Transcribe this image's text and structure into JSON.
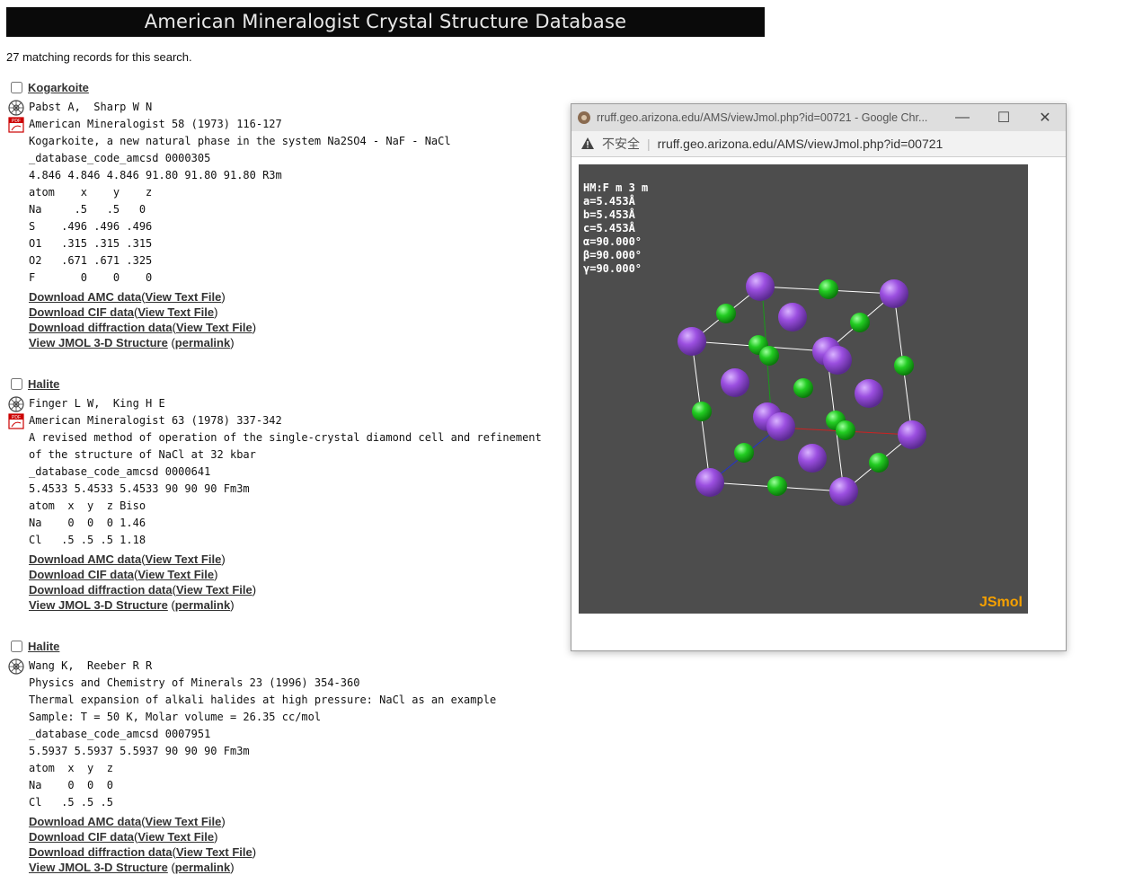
{
  "banner": "American Mineralogist Crystal Structure Database",
  "count_text": "27 matching records for this search.",
  "link_labels": {
    "amc": "Download AMC data",
    "cif": "Download CIF data",
    "diffraction": "Download diffraction data",
    "jmol": "View JMOL 3-D Structure",
    "text_file": "View Text File",
    "permalink": "permalink"
  },
  "records": [
    {
      "title": "Kogarkoite",
      "authors": "Pabst A,  Sharp W N",
      "journal": "American Mineralogist 58 (1973) 116-127",
      "desc": [
        "Kogarkoite, a new natural phase in the system Na2SO4 - NaF - NaCl"
      ],
      "code": "_database_code_amcsd 0000305",
      "cell": "4.846 4.846 4.846 91.80 91.80 91.80 R3m",
      "atoms": [
        "atom    x    y    z",
        "Na     .5   .5   0",
        "S    .496 .496 .496",
        "O1   .315 .315 .315",
        "O2   .671 .671 .325",
        "F       0    0    0"
      ]
    },
    {
      "title": "Halite",
      "authors": "Finger L W,  King H E",
      "journal": "American Mineralogist 63 (1978) 337-342",
      "desc": [
        "A revised method of operation of the single-crystal diamond cell and refinement",
        "of the structure of NaCl at 32 kbar"
      ],
      "code": "_database_code_amcsd 0000641",
      "cell": "5.4533 5.4533 5.4533 90 90 90 Fm3m",
      "atoms": [
        "atom  x  y  z Biso",
        "Na    0  0  0 1.46",
        "Cl   .5 .5 .5 1.18"
      ]
    },
    {
      "title": "Halite",
      "authors": "Wang K,  Reeber R R",
      "journal": "Physics and Chemistry of Minerals 23 (1996) 354-360",
      "desc": [
        "Thermal expansion of alkali halides at high pressure: NaCl as an example",
        "Sample: T = 50 K, Molar volume = 26.35 cc/mol"
      ],
      "code": "_database_code_amcsd 0007951",
      "cell": "5.5937 5.5937 5.5937 90 90 90 Fm3m",
      "atoms": [
        "atom  x  y  z",
        "Na    0  0  0",
        "Cl   .5 .5 .5"
      ]
    }
  ],
  "popup": {
    "title": "rruff.geo.arizona.edu/AMS/viewJmol.php?id=00721 - Google Chr...",
    "insecure": "不安全",
    "url": "rruff.geo.arizona.edu/AMS/viewJmol.php?id=00721",
    "info": [
      "HM:F m 3 m",
      "a=5.453Å",
      "b=5.453Å",
      "c=5.453Å",
      "α=90.000°",
      "β=90.000°",
      "γ=90.000°"
    ],
    "brand": "JSmol",
    "colors": {
      "na": "#9b4fe0",
      "cl": "#22cc22",
      "viewer_bg": "#4d4d4d",
      "brand": "#f5a000"
    }
  }
}
